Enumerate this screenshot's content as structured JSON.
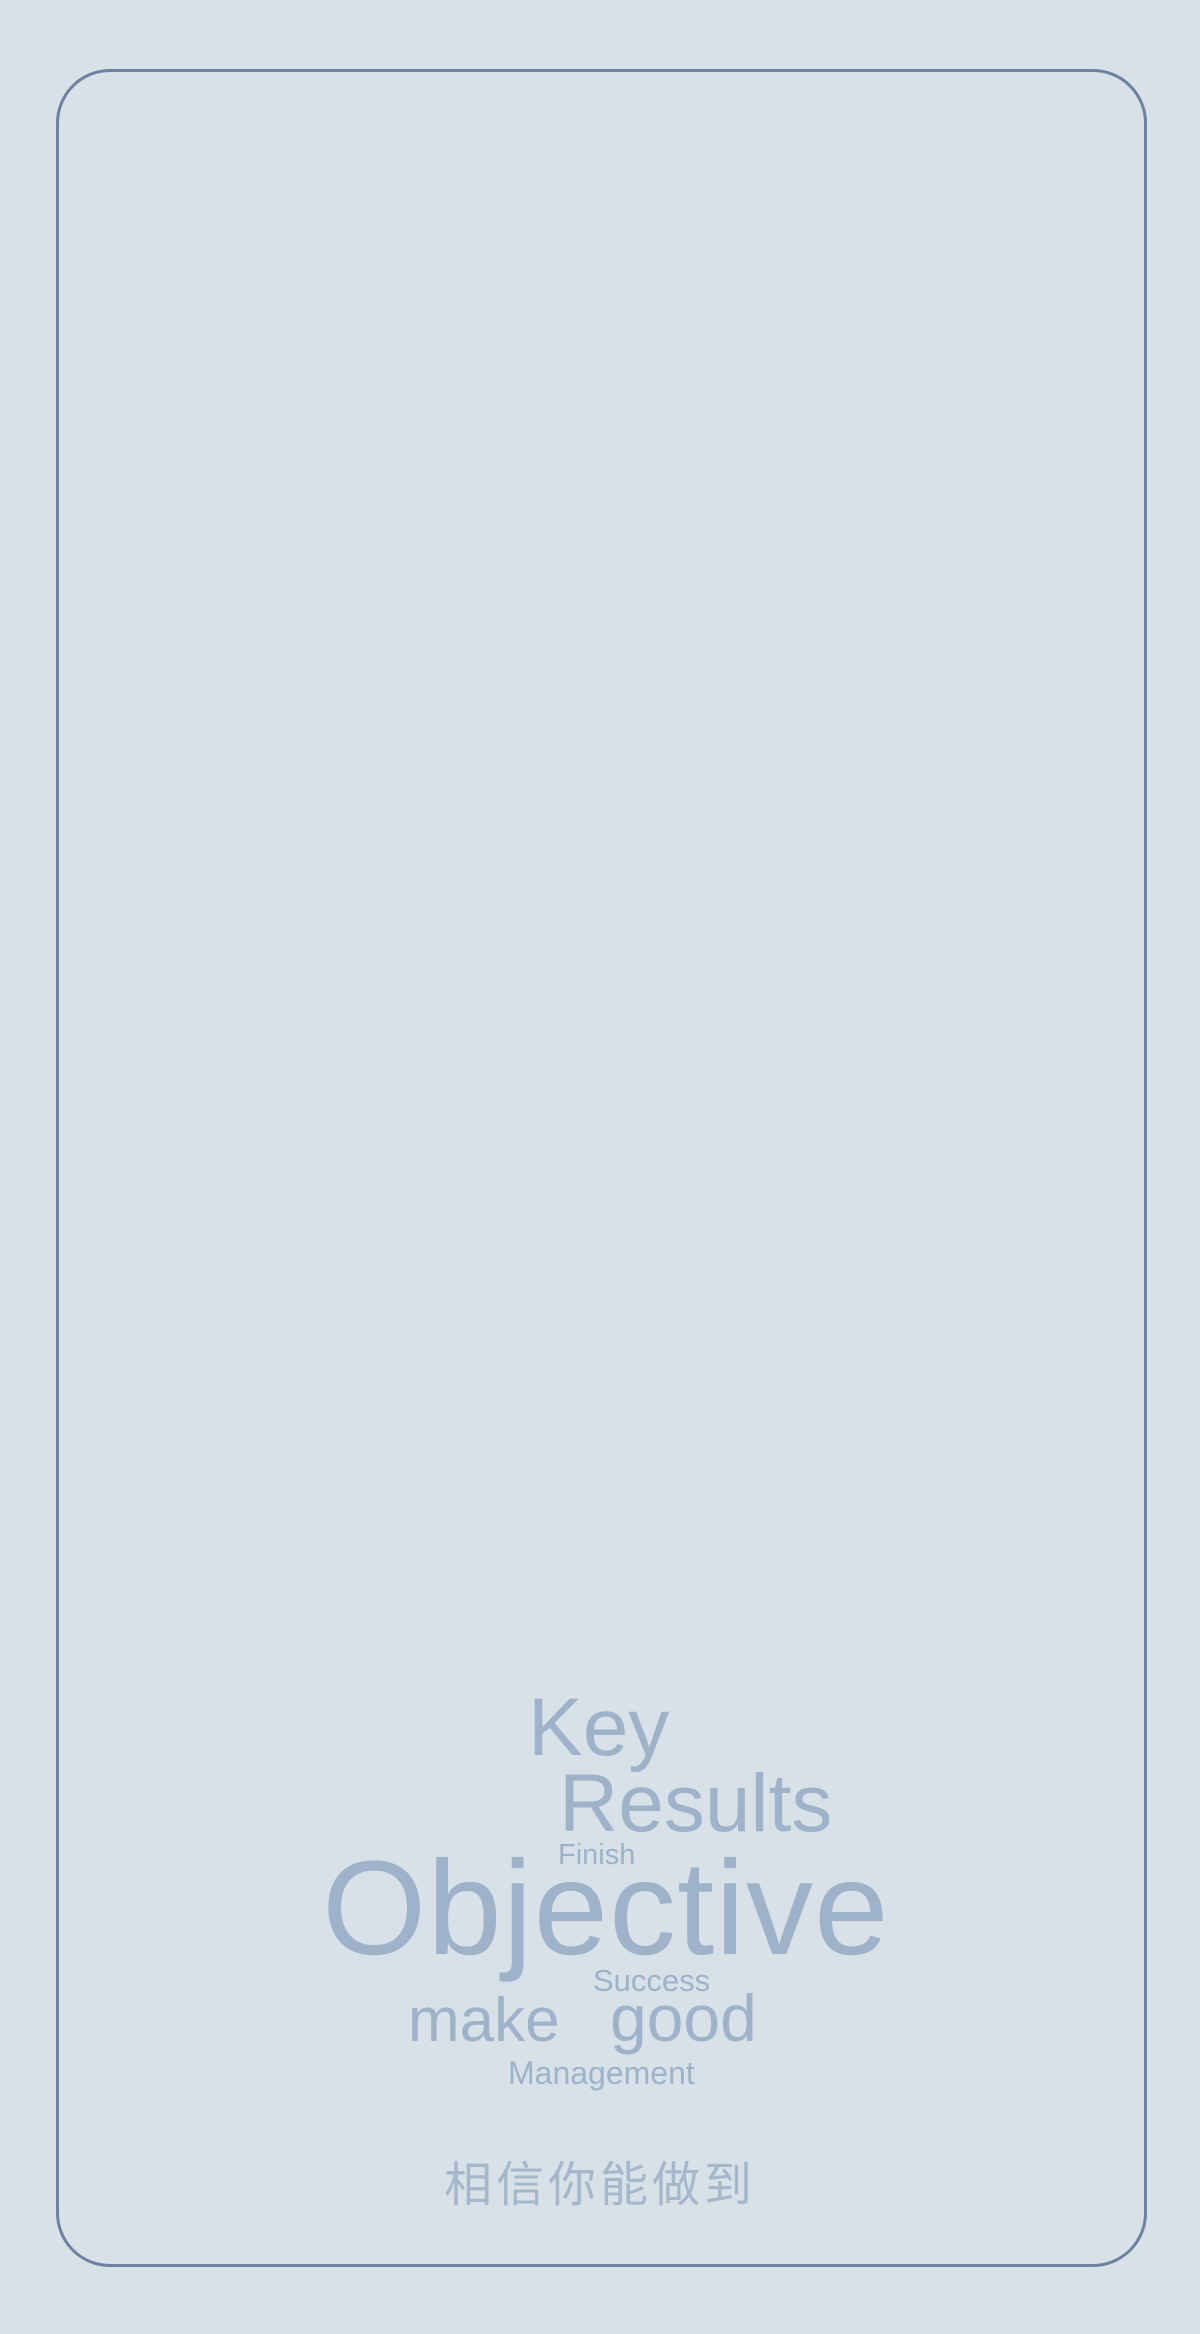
{
  "colors": {
    "background": "#d8e1e8",
    "card_border": "#6c82a0",
    "word_cloud": "#9eb2c9",
    "tagline": "#a6b7cb"
  },
  "word_cloud": {
    "key": "Key",
    "results": "Results",
    "finish": "Finish",
    "objective": "Objective",
    "success": "Success",
    "make": "make",
    "good": "good",
    "management": "Management"
  },
  "tagline": "相信你能做到"
}
